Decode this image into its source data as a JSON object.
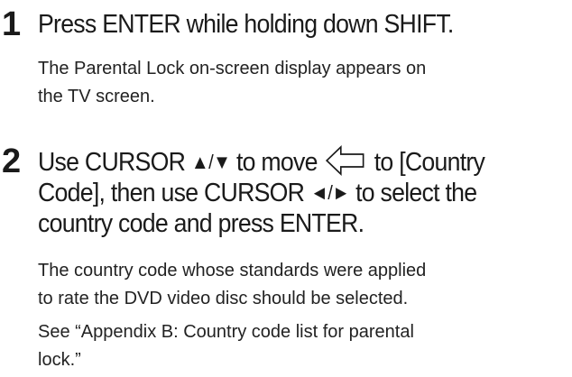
{
  "steps": [
    {
      "number": "1",
      "heading": "Press ENTER while holding down SHIFT.",
      "body": [
        "The Parental Lock on-screen display appears on",
        "the TV screen."
      ]
    },
    {
      "number": "2",
      "heading_line1_part1": "Use CURSOR ",
      "heading_line1_symbols": "▲/▼",
      "heading_line1_part2": " to move ",
      "heading_line1_part3": " to [Country",
      "heading_line2_part1": "Code], then use CURSOR ",
      "heading_line2_symbols": "◄/►",
      "heading_line2_part2": " to select the",
      "heading_line3": "country code and press ENTER.",
      "body": [
        "The country code whose standards were applied",
        "to rate the DVD video disc should be selected.",
        "See “Appendix B: Country code list for parental",
        "lock.”"
      ]
    }
  ],
  "icons": {
    "pointer_arrow": "left-pointing-outline-arrow-icon"
  }
}
